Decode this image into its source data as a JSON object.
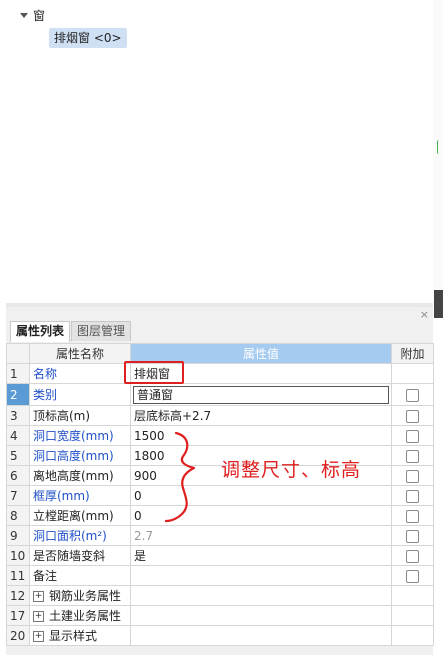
{
  "tree": {
    "root_label": "窗",
    "child_label": "排烟窗 <0>"
  },
  "panel": {
    "close_label": "×",
    "tabs": [
      {
        "label": "属性列表",
        "active": true
      },
      {
        "label": "图层管理",
        "active": false
      }
    ]
  },
  "table": {
    "headers": {
      "name": "属性名称",
      "value": "属性值",
      "add": "附加"
    },
    "rows": [
      {
        "num": "1",
        "name": "名称",
        "value": "排烟窗",
        "blue": true
      },
      {
        "num": "2",
        "name": "类别",
        "value": "普通窗",
        "blue": true,
        "selected": true,
        "checkbox": true
      },
      {
        "num": "3",
        "name": "顶标高(m)",
        "value": "层底标高+2.7",
        "checkbox": true
      },
      {
        "num": "4",
        "name": "洞口宽度(mm)",
        "value": "1500",
        "blue": true,
        "checkbox": true
      },
      {
        "num": "5",
        "name": "洞口高度(mm)",
        "value": "1800",
        "blue": true,
        "checkbox": true
      },
      {
        "num": "6",
        "name": "离地高度(mm)",
        "value": "900",
        "checkbox": true
      },
      {
        "num": "7",
        "name": "框厚(mm)",
        "value": "0",
        "blue": true,
        "checkbox": true
      },
      {
        "num": "8",
        "name": "立樘距离(mm)",
        "value": "0",
        "checkbox": true
      },
      {
        "num": "9",
        "name": "洞口面积(m²)",
        "value": "2.7",
        "blue": true,
        "gray": true,
        "checkbox": true
      },
      {
        "num": "10",
        "name": "是否随墙变斜",
        "value": "是",
        "checkbox": true
      },
      {
        "num": "11",
        "name": "备注",
        "value": "",
        "checkbox": true
      },
      {
        "num": "12",
        "name": "钢筋业务属性",
        "value": "",
        "group": true
      },
      {
        "num": "17",
        "name": "土建业务属性",
        "value": "",
        "group": true
      },
      {
        "num": "20",
        "name": "显示样式",
        "value": "",
        "group": true
      }
    ]
  },
  "annotation": {
    "text": "调整尺寸、标高",
    "color": "#e02020"
  }
}
